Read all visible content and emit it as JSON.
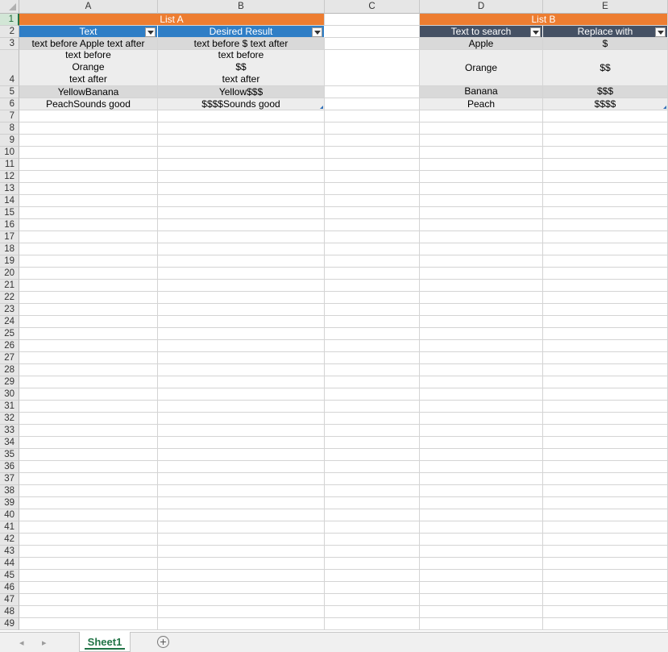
{
  "columns": [
    "A",
    "B",
    "C",
    "D",
    "E"
  ],
  "rows": [
    "1",
    "2",
    "3",
    "4",
    "5",
    "6",
    "7",
    "8",
    "9",
    "10",
    "11",
    "12",
    "13",
    "14",
    "15",
    "16",
    "17",
    "18",
    "19",
    "20",
    "21",
    "22",
    "23",
    "24",
    "25",
    "26",
    "27",
    "28",
    "29",
    "30",
    "31",
    "32",
    "33",
    "34",
    "35",
    "36",
    "37",
    "38",
    "39",
    "40",
    "41",
    "42",
    "43",
    "44",
    "45",
    "46",
    "47",
    "48",
    "49"
  ],
  "selected_row": "1",
  "colors": {
    "orange": "#ed7d31",
    "blue_header": "#2f7ec6",
    "slate_header": "#455164",
    "band_dark": "#d9d9d9",
    "band_light": "#ededed",
    "tab_green": "#217346"
  },
  "list_a": {
    "title": "List A",
    "headers": [
      "Text",
      "Desired Result"
    ],
    "rows": [
      [
        "text before Apple text after",
        "text before $ text after"
      ],
      [
        "text before\nOrange\ntext after",
        "text before\n$$\ntext after"
      ],
      [
        "YellowBanana",
        "Yellow$$$"
      ],
      [
        "PeachSounds good",
        "$$$$Sounds good"
      ]
    ]
  },
  "list_b": {
    "title": "List B",
    "headers": [
      "Text to search",
      "Replace with"
    ],
    "rows": [
      [
        "Apple",
        "$"
      ],
      [
        "Orange",
        "$$"
      ],
      [
        "Banana",
        "$$$"
      ],
      [
        "Peach",
        "$$$$"
      ]
    ]
  },
  "sheet_tab": "Sheet1",
  "icons": {
    "add_sheet": "plus-circle-icon",
    "prev": "triangle-left-icon",
    "next": "triangle-right-icon",
    "filter": "dropdown-arrow-icon"
  }
}
